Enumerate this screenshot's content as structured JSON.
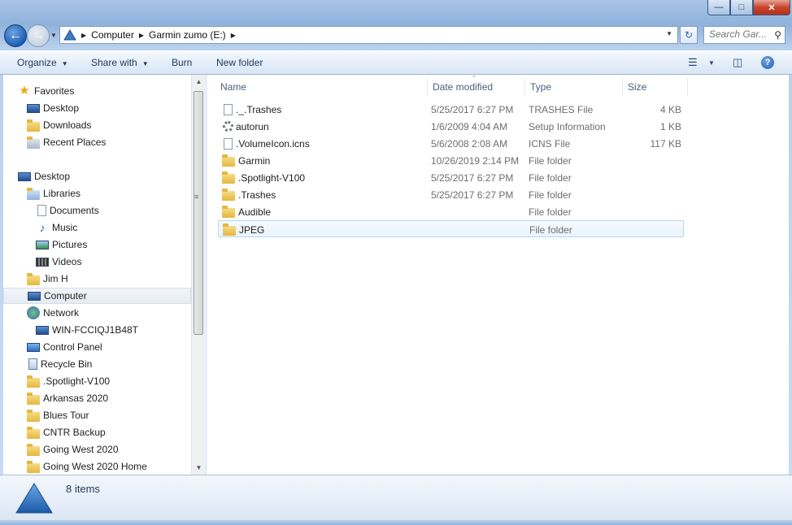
{
  "window": {
    "caption_buttons": {
      "minimize": "—",
      "maximize": "□",
      "close": "✕"
    }
  },
  "address_bar": {
    "breadcrumbs": [
      "Computer",
      "Garmin zumo (E:)"
    ],
    "search_placeholder": "Search Gar..."
  },
  "toolbar": {
    "organize": "Organize",
    "share_with": "Share with",
    "burn": "Burn",
    "new_folder": "New folder",
    "help": "?"
  },
  "nav_pane": {
    "items": [
      {
        "label": "Favorites",
        "icon": "star-icon"
      },
      {
        "label": "Desktop",
        "icon": "desktop-icon"
      },
      {
        "label": "Downloads",
        "icon": "downloads-folder-icon"
      },
      {
        "label": "Recent Places",
        "icon": "recent-places-icon"
      },
      {
        "label": "Desktop",
        "icon": "desktop-icon"
      },
      {
        "label": "Libraries",
        "icon": "libraries-icon"
      },
      {
        "label": "Documents",
        "icon": "documents-icon"
      },
      {
        "label": "Music",
        "icon": "music-icon"
      },
      {
        "label": "Pictures",
        "icon": "pictures-icon"
      },
      {
        "label": "Videos",
        "icon": "videos-icon"
      },
      {
        "label": "Jim H",
        "icon": "user-folder-icon"
      },
      {
        "label": "Computer",
        "icon": "computer-icon",
        "selected": true
      },
      {
        "label": "Network",
        "icon": "network-icon"
      },
      {
        "label": "WIN-FCCIQJ1B48T",
        "icon": "network-computer-icon"
      },
      {
        "label": "Control Panel",
        "icon": "control-panel-icon"
      },
      {
        "label": "Recycle Bin",
        "icon": "recycle-bin-icon"
      },
      {
        "label": ".Spotlight-V100",
        "icon": "folder-icon"
      },
      {
        "label": "Arkansas 2020",
        "icon": "folder-icon"
      },
      {
        "label": "Blues Tour",
        "icon": "folder-icon"
      },
      {
        "label": "CNTR Backup",
        "icon": "folder-icon"
      },
      {
        "label": "Going West 2020",
        "icon": "folder-icon"
      },
      {
        "label": "Going West 2020 Home",
        "icon": "folder-icon"
      }
    ]
  },
  "file_list": {
    "columns": [
      "Name",
      "Date modified",
      "Type",
      "Size"
    ],
    "rows": [
      {
        "name": "._.Trashes",
        "date": "5/25/2017 6:27 PM",
        "type": "TRASHES File",
        "size": "4 KB",
        "icon": "file-icon"
      },
      {
        "name": "autorun",
        "date": "1/6/2009 4:04 AM",
        "type": "Setup Information",
        "size": "1 KB",
        "icon": "settings-file-icon"
      },
      {
        "name": ".VolumeIcon.icns",
        "date": "5/6/2008 2:08 AM",
        "type": "ICNS File",
        "size": "117 KB",
        "icon": "file-icon"
      },
      {
        "name": "Garmin",
        "date": "10/26/2019 2:14 PM",
        "type": "File folder",
        "size": "",
        "icon": "folder-icon"
      },
      {
        "name": ".Spotlight-V100",
        "date": "5/25/2017 6:27 PM",
        "type": "File folder",
        "size": "",
        "icon": "folder-icon"
      },
      {
        "name": ".Trashes",
        "date": "5/25/2017 6:27 PM",
        "type": "File folder",
        "size": "",
        "icon": "folder-icon"
      },
      {
        "name": "Audible",
        "date": "",
        "type": "File folder",
        "size": "",
        "icon": "folder-icon"
      },
      {
        "name": "JPEG",
        "date": "",
        "type": "File folder",
        "size": "",
        "icon": "folder-icon",
        "selected": true
      }
    ]
  },
  "status_bar": {
    "item_count": "8 items"
  },
  "colors": {
    "accent": "#1d5fb5",
    "selection_border": "#b7d7f3",
    "folder": "#e4b740"
  }
}
